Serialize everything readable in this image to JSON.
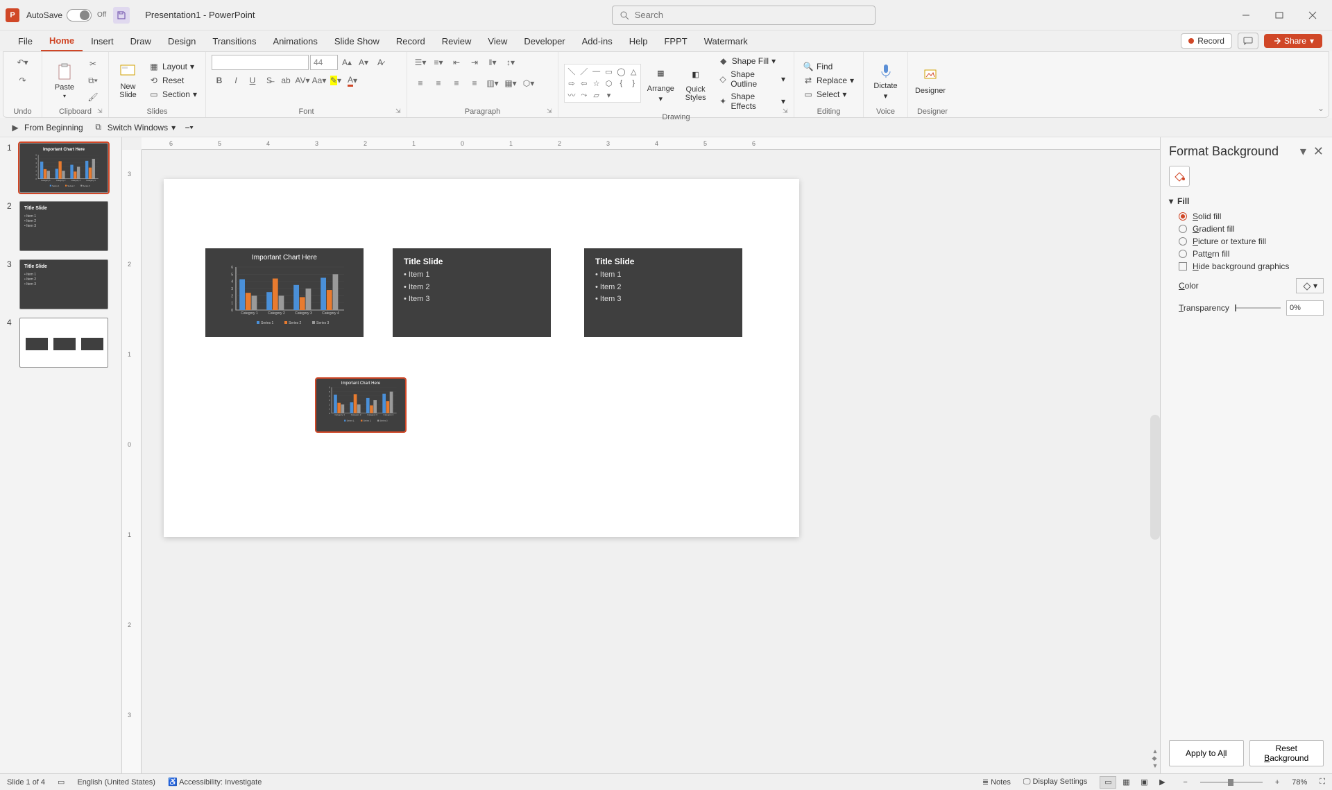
{
  "titlebar": {
    "autosave_label": "AutoSave",
    "autosave_state": "Off",
    "doc_title": "Presentation1 - PowerPoint",
    "search_placeholder": "Search"
  },
  "tabs": [
    "File",
    "Home",
    "Insert",
    "Draw",
    "Design",
    "Transitions",
    "Animations",
    "Slide Show",
    "Record",
    "Review",
    "View",
    "Developer",
    "Add-ins",
    "Help",
    "FPPT",
    "Watermark"
  ],
  "active_tab": "Home",
  "ribbon_right": {
    "record": "Record",
    "share": "Share"
  },
  "ribbon": {
    "undo": {
      "group": "Undo"
    },
    "clipboard": {
      "paste": "Paste",
      "group": "Clipboard"
    },
    "slides": {
      "new_slide": "New\nSlide",
      "layout": "Layout",
      "reset": "Reset",
      "section": "Section",
      "group": "Slides"
    },
    "font": {
      "size": "44",
      "group": "Font"
    },
    "paragraph": {
      "group": "Paragraph"
    },
    "drawing": {
      "arrange": "Arrange",
      "quick_styles": "Quick\nStyles",
      "shape_fill": "Shape Fill",
      "shape_outline": "Shape Outline",
      "shape_effects": "Shape Effects",
      "group": "Drawing"
    },
    "editing": {
      "find": "Find",
      "replace": "Replace",
      "select": "Select",
      "group": "Editing"
    },
    "voice": {
      "dictate": "Dictate",
      "group": "Voice"
    },
    "designer": {
      "designer": "Designer",
      "group": "Designer"
    }
  },
  "qat": {
    "from_beginning": "From Beginning",
    "switch_windows": "Switch Windows"
  },
  "thumbnails": [
    {
      "num": "1",
      "selected": true,
      "type": "chart"
    },
    {
      "num": "2",
      "selected": false,
      "type": "title",
      "title": "Title Slide",
      "items": [
        "• Item 1",
        "• Item 2",
        "• Item 3"
      ]
    },
    {
      "num": "3",
      "selected": false,
      "type": "title",
      "title": "Title Slide",
      "items": [
        "• Item 1",
        "• Item 2",
        "• Item 3"
      ]
    },
    {
      "num": "4",
      "selected": false,
      "type": "light-multi"
    }
  ],
  "canvas_objects": {
    "chart_slide": {
      "title": "Important Chart Here"
    },
    "title_slide_a": {
      "title": "Title Slide",
      "items": [
        "• Item 1",
        "• Item 2",
        "• Item 3"
      ]
    },
    "title_slide_b": {
      "title": "Title Slide",
      "items": [
        "• Item 1",
        "• Item 2",
        "• Item 3"
      ]
    }
  },
  "chart_data": {
    "type": "bar",
    "title": "Important Chart Here",
    "categories": [
      "Category 1",
      "Category 2",
      "Category 3",
      "Category 4"
    ],
    "series": [
      {
        "name": "Series 1",
        "color": "#4a90d9",
        "values": [
          4.3,
          2.5,
          3.5,
          4.5
        ]
      },
      {
        "name": "Series 2",
        "color": "#e87b2f",
        "values": [
          2.4,
          4.4,
          1.8,
          2.8
        ]
      },
      {
        "name": "Series 3",
        "color": "#9a9a9a",
        "values": [
          2.0,
          2.0,
          3.0,
          5.0
        ]
      }
    ],
    "ylim": [
      0,
      6
    ],
    "yticks": [
      0,
      1,
      2,
      3,
      4,
      5,
      6
    ]
  },
  "ruler_marks": [
    "6",
    "5",
    "4",
    "3",
    "2",
    "1",
    "0",
    "1",
    "2",
    "3",
    "4",
    "5",
    "6"
  ],
  "ruler_v_marks": [
    "3",
    "2",
    "1",
    "0",
    "1",
    "2",
    "3"
  ],
  "format_pane": {
    "title": "Format Background",
    "fill_header": "Fill",
    "options": {
      "solid": "Solid fill",
      "gradient": "Gradient fill",
      "picture": "Picture or texture fill",
      "pattern": "Pattern fill"
    },
    "hide_bg": "Hide background graphics",
    "color_label": "Color",
    "transparency_label": "Transparency",
    "transparency_value": "0%",
    "apply_all": "Apply to All",
    "reset_bg": "Reset Background"
  },
  "statusbar": {
    "slide_pos": "Slide 1 of 4",
    "lang": "English (United States)",
    "accessibility": "Accessibility: Investigate",
    "notes": "Notes",
    "display": "Display Settings",
    "zoom": "78%"
  }
}
